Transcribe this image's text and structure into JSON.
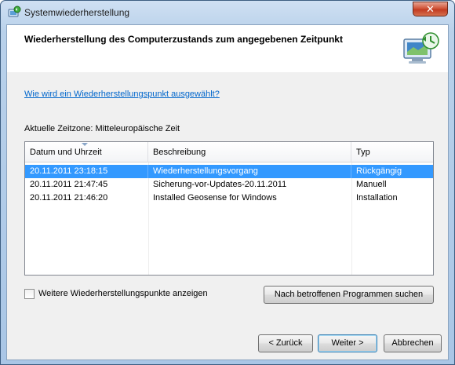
{
  "window": {
    "title": "Systemwiederherstellung",
    "close_label": "✕"
  },
  "header": {
    "title": "Wiederherstellung des Computerzustands zum angegebenen Zeitpunkt"
  },
  "help_link": "Wie wird ein Wiederherstellungspunkt ausgewählt?",
  "timezone": "Aktuelle Zeitzone: Mitteleuropäische Zeit",
  "table": {
    "columns": [
      "Datum und Uhrzeit",
      "Beschreibung",
      "Typ"
    ],
    "sorted_column": "Datum und Uhrzeit",
    "rows": [
      {
        "date": "20.11.2011 23:18:15",
        "description": "Wiederherstellungsvorgang",
        "type": "Rückgängig",
        "selected": true
      },
      {
        "date": "20.11.2011 21:47:45",
        "description": "Sicherung-vor-Updates-20.11.2011",
        "type": "Manuell",
        "selected": false
      },
      {
        "date": "20.11.2011 21:46:20",
        "description": "Installed Geosense for Windows",
        "type": "Installation",
        "selected": false
      }
    ]
  },
  "checkbox": {
    "label": "Weitere Wiederherstellungspunkte anzeigen",
    "checked": false
  },
  "buttons": {
    "search": "Nach betroffenen Programmen suchen",
    "back": "< Zurück",
    "next": "Weiter >",
    "cancel": "Abbrechen"
  },
  "colors": {
    "selection": "#3399ff",
    "link": "#0066cc",
    "close_button": "#c23c22"
  },
  "icons": [
    "system-restore-icon",
    "system-restore-large-icon",
    "close-icon",
    "sort-arrow-icon"
  ]
}
